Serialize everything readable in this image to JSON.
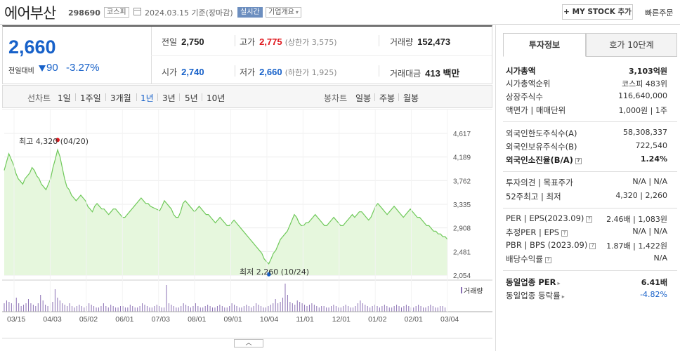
{
  "header": {
    "name": "에어부산",
    "code": "298690",
    "market": "코스피",
    "date": "2024.03.15 기준(장마감)",
    "realtime": "실시간",
    "company_info": "기업개요",
    "my_stock": "+ MY STOCK 추가",
    "fast_order": "빠른주문"
  },
  "price": {
    "current": "2,660",
    "prev_label": "전일대비",
    "change": "90",
    "change_pct": "-3.27%",
    "prev_close": {
      "label": "전일",
      "value": "2,750"
    },
    "high": {
      "label": "고가",
      "value": "2,775",
      "sub": "(상한가 3,575)"
    },
    "volume": {
      "label": "거래량",
      "value": "152,473"
    },
    "open": {
      "label": "시가",
      "value": "2,740"
    },
    "low": {
      "label": "저가",
      "value": "2,660",
      "sub": "(하한가 1,925)"
    },
    "amount": {
      "label": "거래대금",
      "value": "413 백만"
    }
  },
  "period": {
    "line_label": "선차트",
    "line_items": [
      "1일",
      "1주일",
      "3개월",
      "1년",
      "3년",
      "5년",
      "10년"
    ],
    "active": "1년",
    "candle_label": "봉차트",
    "candle_items": [
      "일봉",
      "주봉",
      "월봉"
    ]
  },
  "chart_data": {
    "type": "area",
    "y_ticks": [
      "4,617",
      "4,189",
      "3,762",
      "3,335",
      "2,908",
      "2,481",
      "2,054"
    ],
    "ylim": [
      2054,
      4617
    ],
    "x_labels": [
      "03/15",
      "04/03",
      "05/02",
      "06/01",
      "07/03",
      "08/01",
      "09/01",
      "10/04",
      "11/01",
      "12/01",
      "01/02",
      "02/01",
      "03/04"
    ],
    "high_annotation": "최고 4,320 (04/20)",
    "low_annotation": "최저 2,260 (10/24)",
    "volume_label": "거래량",
    "prices": [
      3950,
      4100,
      4250,
      4150,
      4050,
      3900,
      3800,
      3750,
      3700,
      3800,
      3850,
      3900,
      4000,
      3950,
      3850,
      3800,
      3700,
      3650,
      3600,
      3700,
      3800,
      4000,
      4150,
      4320,
      4200,
      4000,
      3800,
      3650,
      3600,
      3500,
      3450,
      3400,
      3450,
      3500,
      3450,
      3400,
      3300,
      3250,
      3200,
      3300,
      3350,
      3300,
      3250,
      3250,
      3200,
      3150,
      3200,
      3250,
      3250,
      3200,
      3150,
      3100,
      3100,
      3150,
      3200,
      3250,
      3300,
      3350,
      3400,
      3450,
      3400,
      3350,
      3350,
      3300,
      3280,
      3260,
      3240,
      3220,
      3300,
      3400,
      3350,
      3300,
      3250,
      3150,
      3100,
      3100,
      3200,
      3350,
      3400,
      3350,
      3300,
      3250,
      3200,
      3250,
      3300,
      3250,
      3200,
      3150,
      3150,
      3100,
      3050,
      3000,
      3050,
      3100,
      3050,
      3000,
      2950,
      2950,
      3000,
      3050,
      3000,
      2950,
      2900,
      2850,
      2800,
      2750,
      2700,
      2650,
      2600,
      2550,
      2500,
      2450,
      2350,
      2300,
      2260,
      2350,
      2450,
      2500,
      2600,
      2700,
      2750,
      2800,
      2850,
      2950,
      3050,
      3150,
      3100,
      3000,
      2950,
      2950,
      3000,
      3000,
      3050,
      3100,
      3150,
      3100,
      3050,
      3000,
      2950,
      2950,
      3000,
      3050,
      3100,
      3050,
      3000,
      2950,
      2950,
      3000,
      3050,
      3100,
      3150,
      3100,
      3150,
      3200,
      3200,
      3150,
      3100,
      3050,
      3100,
      3200,
      3300,
      3350,
      3300,
      3250,
      3200,
      3150,
      3200,
      3250,
      3300,
      3250,
      3200,
      3150,
      3100,
      3150,
      3200,
      3250,
      3200,
      3150,
      3100,
      3100,
      3050,
      3000,
      2950,
      2950,
      2900,
      2850,
      2850,
      2800,
      2800,
      2750,
      2750,
      2700
    ],
    "volumes": [
      0.3,
      0.4,
      0.35,
      0.3,
      0.25,
      0.5,
      0.3,
      0.2,
      0.25,
      0.3,
      0.45,
      0.3,
      0.25,
      0.2,
      0.3,
      0.6,
      0.4,
      0.25,
      0.2,
      0.3,
      0.35,
      0.8,
      0.5,
      0.4,
      0.3,
      0.25,
      0.2,
      0.3,
      0.2,
      0.15,
      0.2,
      0.25,
      0.2,
      0.15,
      0.2,
      0.3,
      0.25,
      0.2,
      0.15,
      0.15,
      0.2,
      0.3,
      0.2,
      0.15,
      0.25,
      0.2,
      0.15,
      0.15,
      0.2,
      0.2,
      0.15,
      0.15,
      0.25,
      0.2,
      0.15,
      0.15,
      0.2,
      0.3,
      0.25,
      0.2,
      0.15,
      0.15,
      0.2,
      0.25,
      0.2,
      0.15,
      0.15,
      0.95,
      0.3,
      0.25,
      0.2,
      0.15,
      0.15,
      0.2,
      0.3,
      0.25,
      0.2,
      0.15,
      0.2,
      0.3,
      0.2,
      0.15,
      0.15,
      0.2,
      0.25,
      0.2,
      0.15,
      0.15,
      0.2,
      0.25,
      0.2,
      0.15,
      0.15,
      0.2,
      0.3,
      0.25,
      0.2,
      0.15,
      0.15,
      0.2,
      0.25,
      0.2,
      0.15,
      0.2,
      0.3,
      0.25,
      0.2,
      0.15,
      0.15,
      0.2,
      0.25,
      0.3,
      0.45,
      0.3,
      0.35,
      0.5,
      1.0,
      0.6,
      0.35,
      0.3,
      0.25,
      0.4,
      0.35,
      0.3,
      0.25,
      0.2,
      0.25,
      0.3,
      0.25,
      0.2,
      0.15,
      0.2,
      0.2,
      0.15,
      0.15,
      0.2,
      0.25,
      0.2,
      0.15,
      0.15,
      0.2,
      0.25,
      0.2,
      0.15,
      0.15,
      0.2,
      0.3,
      0.4,
      0.3,
      0.25,
      0.2,
      0.15,
      0.2,
      0.25,
      0.2,
      0.15,
      0.2,
      0.25,
      0.2,
      0.15,
      0.15,
      0.2,
      0.25,
      0.2,
      0.15,
      0.2,
      0.25,
      0.2,
      0.15,
      0.15,
      0.2,
      0.25,
      0.2,
      0.15,
      0.15,
      0.2,
      0.25,
      0.2,
      0.15,
      0.15,
      0.2,
      0.2,
      0.15,
      0.15
    ]
  },
  "panel": {
    "tab_active": "투자정보",
    "tab_other": "호가 10단계",
    "rows": [
      {
        "k": "시가총액",
        "v": "3,103억원",
        "kb": true,
        "vb": true
      },
      {
        "k": "시가총액순위",
        "v": "코스피 483위"
      },
      {
        "k": "상장주식수",
        "v": "116,640,000"
      },
      {
        "k": "액면가 | 매매단위",
        "v": "1,000원 | 1주"
      },
      {
        "k": "외국인한도주식수(A)",
        "v": "58,308,337"
      },
      {
        "k": "외국인보유주식수(B)",
        "v": "722,540"
      },
      {
        "k": "외국인소진율(B/A)",
        "v": "1.24%",
        "kb": true,
        "vb": true
      },
      {
        "k": "투자의견 | 목표주가",
        "v": "N/A | N/A"
      },
      {
        "k": "52주최고 | 최저",
        "v": "4,320 | 2,260"
      },
      {
        "k": "PER | EPS(2023.09)",
        "v": "2.46배 | 1,083원"
      },
      {
        "k": "추정PER | EPS",
        "v": "N/A | N/A"
      },
      {
        "k": "PBR | BPS (2023.09)",
        "v": "1.87배 | 1,422원"
      },
      {
        "k": "배당수익률",
        "v": "N/A"
      },
      {
        "k": "동일업종 PER",
        "v": "6.41배",
        "kb": true,
        "vb": true
      },
      {
        "k": "동일업종 등락률",
        "v": "-4.82%",
        "blue": true
      }
    ]
  },
  "colors": {
    "rise": "#e0171d",
    "fall": "#1761c9",
    "area_line": "#6fc95a",
    "area_fill": "#e6f7dd"
  }
}
